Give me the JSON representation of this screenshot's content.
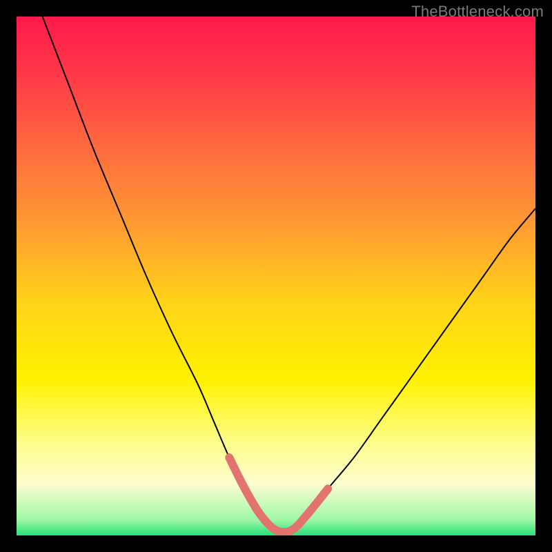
{
  "watermark": "TheBottleneck.com",
  "chart_data": {
    "type": "line",
    "title": "",
    "xlabel": "",
    "ylabel": "",
    "xlim": [
      0,
      100
    ],
    "ylim": [
      0,
      100
    ],
    "grid": false,
    "legend": false,
    "background_gradient": {
      "stops": [
        {
          "offset": 0.0,
          "color": "#ff1a4a"
        },
        {
          "offset": 0.12,
          "color": "#ff3b48"
        },
        {
          "offset": 0.25,
          "color": "#ff6a3f"
        },
        {
          "offset": 0.4,
          "color": "#ff9a32"
        },
        {
          "offset": 0.55,
          "color": "#ffd319"
        },
        {
          "offset": 0.7,
          "color": "#fff200"
        },
        {
          "offset": 0.82,
          "color": "#fdfd8a"
        },
        {
          "offset": 0.9,
          "color": "#fdfdd0"
        },
        {
          "offset": 0.97,
          "color": "#9ef7a6"
        },
        {
          "offset": 1.0,
          "color": "#27e07a"
        }
      ]
    },
    "series": [
      {
        "name": "bottleneck-curve",
        "color": "#000000",
        "stroke_width": 2,
        "x": [
          5,
          10,
          15,
          20,
          25,
          30,
          35,
          38,
          41,
          44,
          47,
          50,
          53,
          56,
          60,
          65,
          70,
          75,
          80,
          85,
          90,
          95,
          100
        ],
        "values": [
          100,
          87,
          74,
          62,
          50,
          39,
          29,
          22,
          15,
          9,
          4,
          1,
          1,
          4,
          9,
          15,
          22,
          29,
          36,
          43,
          50,
          57,
          63
        ]
      },
      {
        "name": "highlight-band",
        "color": "#e2736f",
        "stroke_width": 12,
        "x": [
          41,
          44,
          47,
          50,
          53,
          56,
          60
        ],
        "values": [
          15,
          9,
          4,
          1,
          1,
          4,
          9
        ]
      }
    ]
  }
}
